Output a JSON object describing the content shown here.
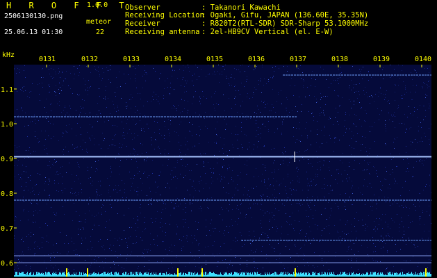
{
  "header": {
    "title": "H R O F F T",
    "version": "1.0.0",
    "filename": "2506130130.png",
    "mode": "meteor",
    "datetime": "25.06.13 01:30",
    "count": "22"
  },
  "meta": {
    "observer_key": "Observer",
    "observer_val": ": Takanori Kawachi",
    "location_key": "Receiving Location",
    "location_val": ": Ogaki, Gifu, JAPAN (136.60E, 35.35N)",
    "receiver_key": "Receiver",
    "receiver_val": ": R820T2(RTL-SDR) SDR-Sharp 53.1000MHz",
    "antenna_key": "Receiving antenna",
    "antenna_val": ": 2el-HB9CV Vertical (el. E-W)"
  },
  "axis": {
    "unit": "kHz",
    "time_ticks": [
      "0131",
      "0132",
      "0133",
      "0134",
      "0135",
      "0136",
      "0137",
      "0138",
      "0139",
      "0140"
    ],
    "freq_ticks": [
      "1.1",
      "1.0",
      "0.9",
      "0.8",
      "0.7",
      "0.6"
    ]
  },
  "colors": {
    "background": "#000000",
    "plot_bg": "#050a3a",
    "header_yellow": "#ffff00",
    "header_green": "#7fff00",
    "signal": "#6fa0ff",
    "baseline": "#3fe0ff"
  },
  "chart_data": {
    "type": "heatmap",
    "x_ticks": [
      "0131",
      "0132",
      "0133",
      "0134",
      "0135",
      "0136",
      "0137",
      "0138",
      "0139",
      "0140"
    ],
    "y_ticks": [
      1.1,
      1.0,
      0.9,
      0.8,
      0.7,
      0.6
    ],
    "ylabel": "kHz",
    "ylim": [
      0.58,
      1.16
    ],
    "traces": [
      {
        "freq_khz": 1.14,
        "from": "0137",
        "to": "0140"
      },
      {
        "freq_khz": 1.02,
        "from": "0131",
        "to": "0137"
      },
      {
        "freq_khz": 0.905,
        "from": "0131",
        "to": "0140"
      },
      {
        "freq_khz": 0.78,
        "from": "0131",
        "to": "0140"
      },
      {
        "freq_khz": 0.665,
        "from": "0136",
        "to": "0140"
      },
      {
        "freq_khz": 0.62,
        "from": "0131",
        "to": "0140"
      },
      {
        "freq_khz": 0.6,
        "from": "0131",
        "to": "0140"
      }
    ]
  }
}
